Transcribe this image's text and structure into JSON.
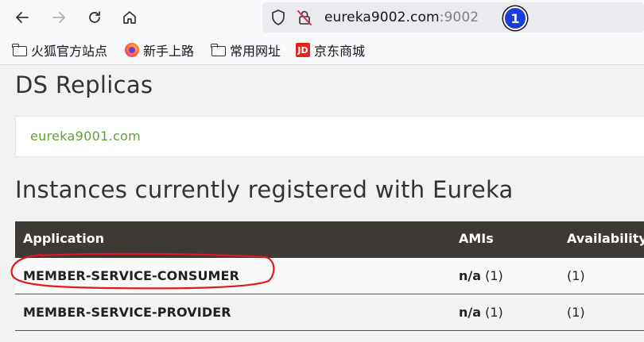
{
  "browser": {
    "url_host": "eureka9002.com",
    "url_port": ":9002",
    "badge_number": "1",
    "icons": [
      "back-arrow-icon",
      "forward-arrow-icon",
      "reload-icon",
      "home-icon",
      "shield-icon",
      "insecure-lock-icon"
    ]
  },
  "bookmarks": [
    {
      "label": "火狐官方站点",
      "icon": "folder-icon"
    },
    {
      "label": "新手上路",
      "icon": "firefox-icon"
    },
    {
      "label": "常用网址",
      "icon": "folder-icon"
    },
    {
      "label": "京东商城",
      "icon": "jd-icon",
      "icon_text": "JD"
    }
  ],
  "page": {
    "replicas_heading": "DS Replicas",
    "replica_link": "eureka9001.com",
    "instances_heading": "Instances currently registered with Eureka",
    "table": {
      "headers": [
        "Application",
        "AMIs",
        "Availability"
      ],
      "rows": [
        {
          "application": "MEMBER-SERVICE-CONSUMER",
          "amis_value": "n/a",
          "amis_count": "(1)",
          "availability": "(1)"
        },
        {
          "application": "MEMBER-SERVICE-PROVIDER",
          "amis_value": "n/a",
          "amis_count": "(1)",
          "availability": "(1)"
        }
      ]
    }
  },
  "colors": {
    "link_green": "#5fa134",
    "table_header_bg": "#3d3a36",
    "annotation_red": "#e0191f",
    "badge_blue": "#1a3fd6"
  }
}
